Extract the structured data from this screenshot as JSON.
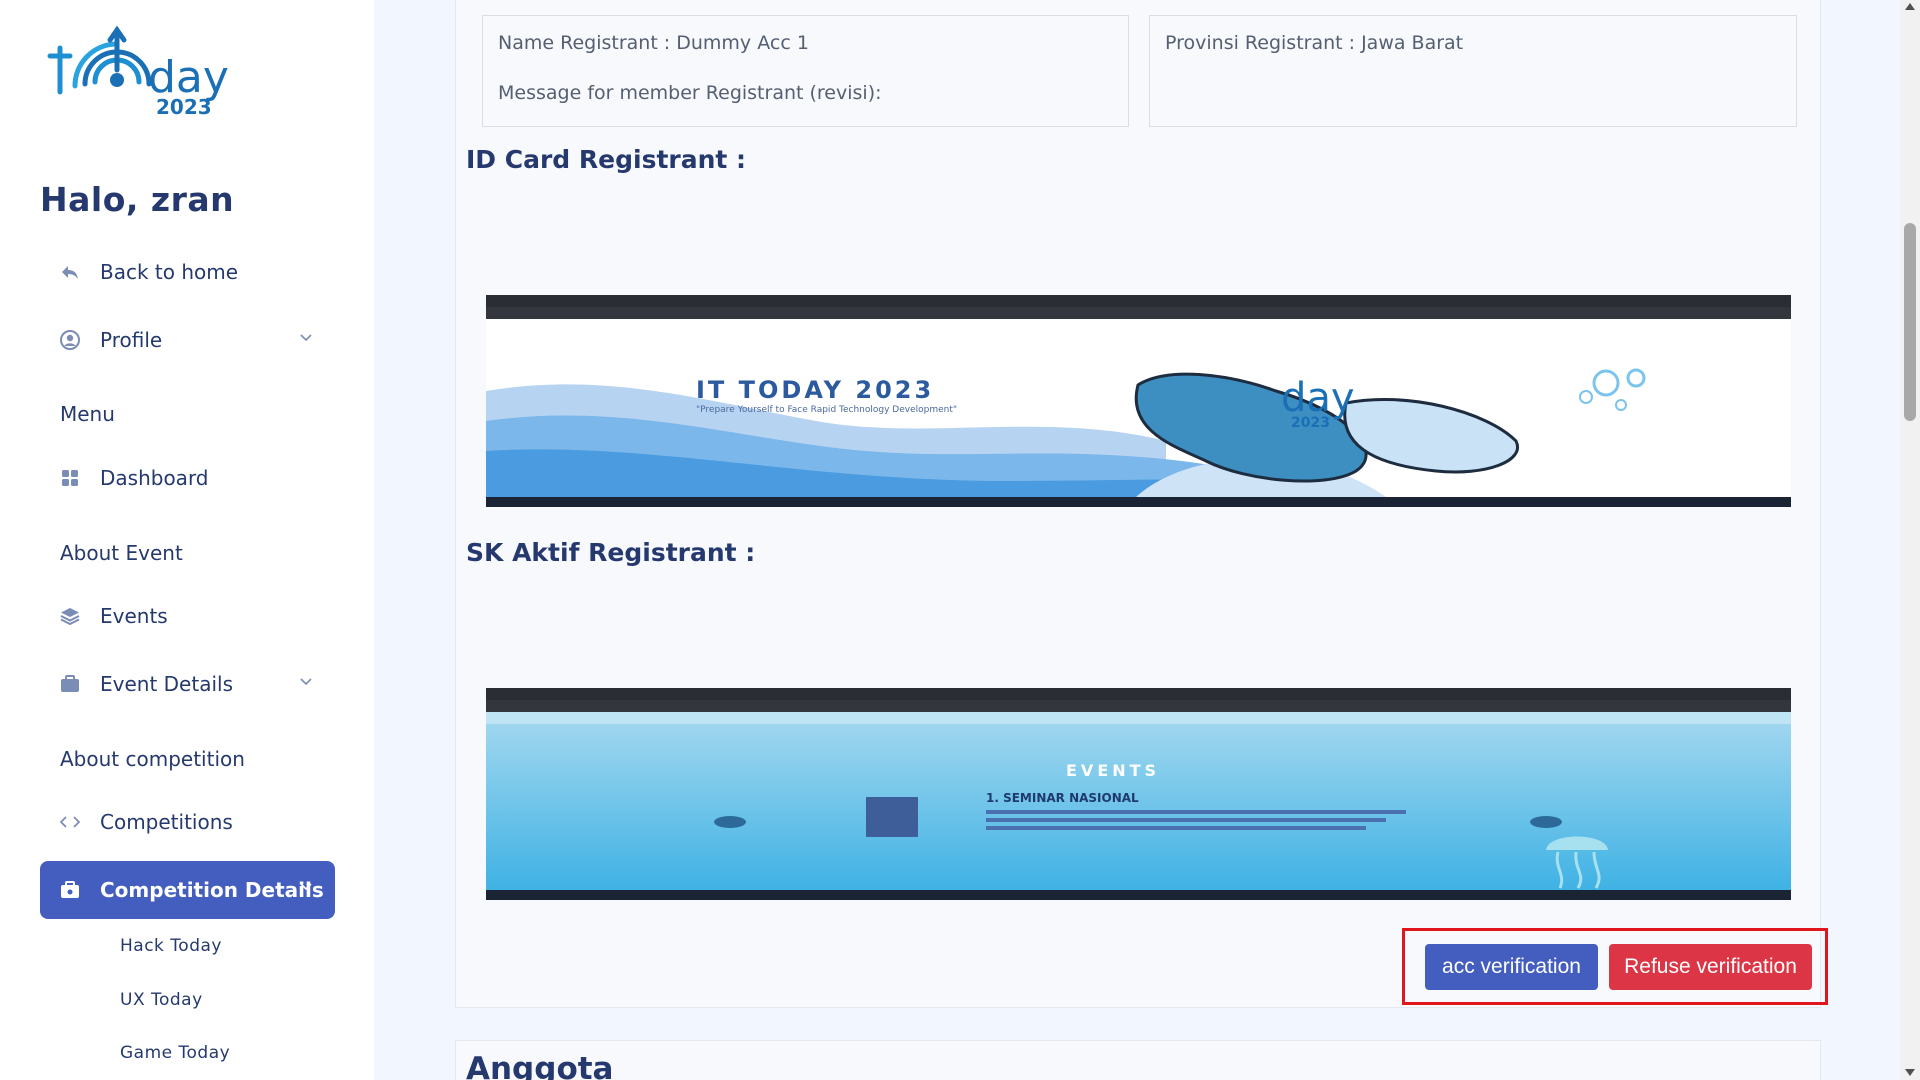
{
  "sidebar": {
    "logo_text": "day",
    "logo_year": "2023",
    "greeting": "Halo, zran",
    "back_home": "Back to home",
    "profile": "Profile",
    "menu_title": "Menu",
    "dashboard": "Dashboard",
    "about_event_title": "About Event",
    "events": "Events",
    "event_details": "Event Details",
    "about_competition_title": "About competition",
    "competitions": "Competitions",
    "competition_details": "Competition Details",
    "sub_items": [
      "Hack Today",
      "UX Today",
      "Game Today"
    ],
    "active_color": "#435ebe"
  },
  "registrant": {
    "name_line": "Name Registrant : Dummy Acc 1",
    "message_line": "Message for member Registrant (revisi):",
    "province_line": "Provinsi Registrant : Jawa Barat",
    "id_card_heading": "ID Card Registrant :",
    "sk_aktif_heading": "SK Aktif Registrant :"
  },
  "id_card_image": {
    "title": "IT TODAY 2023",
    "subtitle": "\"Prepare Yourself to Face Rapid Technology Development\"",
    "logo_text": "day",
    "logo_year": "2023"
  },
  "sk_image": {
    "heading": "EVENTS",
    "item_title": "1. SEMINAR NASIONAL"
  },
  "actions": {
    "acc_label": "acc verification",
    "refuse_label": "Refuse verification",
    "acc_color": "#435ebe",
    "refuse_color": "#dc3545",
    "highlight_color": "#e0161e"
  },
  "members_heading": "Anggota"
}
